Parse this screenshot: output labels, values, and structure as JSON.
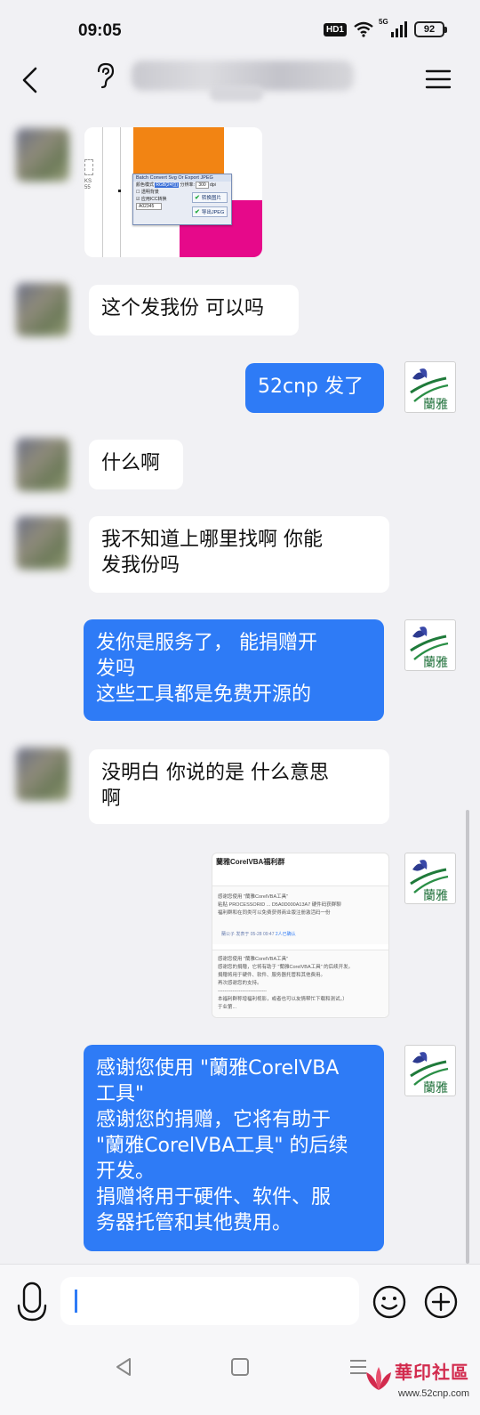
{
  "status_bar": {
    "time": "09:05",
    "hd_badge": "HD1",
    "network_label": "5G",
    "battery": "92"
  },
  "nav": {
    "back_icon": "chevron-left-icon",
    "ear_icon": "ear-icon",
    "menu_icon": "hamburger-menu-icon"
  },
  "messages": [
    {
      "side": "in",
      "type": "image"
    },
    {
      "side": "in",
      "type": "text",
      "text": "这个发我份 可以吗"
    },
    {
      "side": "out",
      "type": "text",
      "text": "52cnp 发了"
    },
    {
      "side": "in",
      "type": "text",
      "text": "什么啊"
    },
    {
      "side": "in",
      "type": "text",
      "text": "我不知道上哪里找啊  你能\n发我份吗"
    },
    {
      "side": "out",
      "type": "text",
      "text": "发你是服务了，  能捐赠开\n发吗\n这些工具都是免费开源的"
    },
    {
      "side": "in",
      "type": "text",
      "text": "没明白 你说的是 什么意思\n啊"
    },
    {
      "side": "out",
      "type": "image"
    },
    {
      "side": "out",
      "type": "text",
      "text": "感谢您使用 \"蘭雅CorelVBA\n工具\"\n感谢您的捐赠，它将有助于\n\"蘭雅CorelVBA工具\" 的后续\n开发。\n捐赠将用于硬件、软件、服\n务器托管和其他费用。"
    }
  ],
  "image1": {
    "dialog_title": "Batch Convert Svg Or Export JPEG",
    "color_mode_label": "颜色模式",
    "color_mode_value": "RGB(24位)",
    "resolution_label": "分辨率:",
    "resolution_value": "300",
    "resolution_unit": "dpi",
    "transparent_bg": "透明背景",
    "apply_icc": "应用ICC转换",
    "convert_button": "转换图片",
    "export_button": "导出JPEG",
    "code_field": "A02345",
    "side_label": "KS\n55"
  },
  "image2": {
    "title": "蘭雅CorelVBA福利群",
    "post1": "感谢您使用 \"蘭雅CorelVBA工具\"\n粘贴 PROCESSORID ... D5A0D000A13A7 硬件码获群聊\n福利群和在同类可以免费获得商业版注册激活码一份",
    "post1_meta": "蘭公子  发表于 05-28 09:47",
    "post1_link": "2人已确认",
    "post2": "感谢您使用 \"蘭雅CorelVBA工具\"\n感谢您的捐赠，它将有助于 \"蘭雅CorelVBA工具\" 的后续开发。\n捐赠将用于硬件、软件、服务器托管和其他费用。\n再次感谢您的支持。\n------------------------------\n本福利群称增福利视影，或者也可以友情帮忙下载和测试，）\n于业第..."
  },
  "avatar_right": {
    "caption": "蘭雅"
  },
  "input": {
    "placeholder": "",
    "value": "",
    "mic_icon": "microphone-icon",
    "emoji_icon": "emoji-icon",
    "plus_icon": "plus-circle-icon"
  },
  "system_nav": {
    "back_icon": "triangle-back-icon",
    "home_icon": "square-home-icon",
    "menu_icon": "recent-apps-icon"
  },
  "watermark": {
    "title": "華印社區",
    "url": "www.52cnp.com"
  },
  "colors": {
    "outgoing_bubble": "#2e7bf6",
    "incoming_bubble": "#ffffff",
    "background": "#f1f1f4"
  }
}
